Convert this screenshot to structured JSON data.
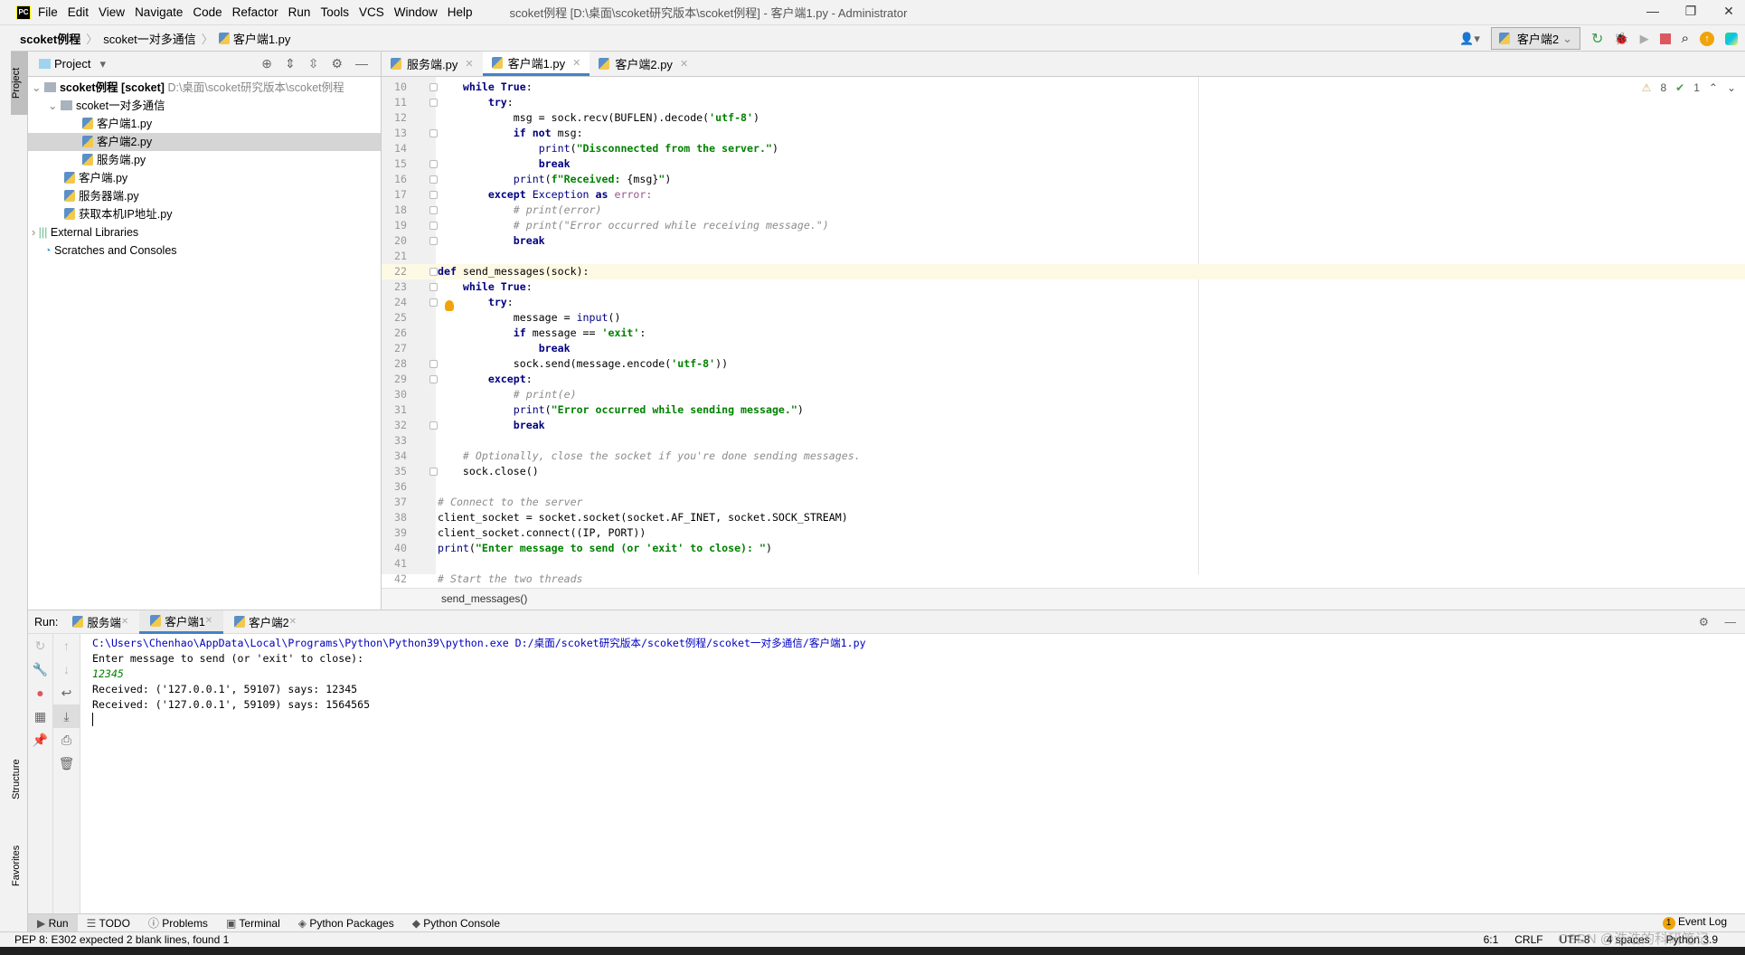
{
  "titlebar": {
    "menus": [
      "File",
      "Edit",
      "View",
      "Navigate",
      "Code",
      "Refactor",
      "Run",
      "Tools",
      "VCS",
      "Window",
      "Help"
    ],
    "title": "scoket例程 [D:\\桌面\\scoket研究版本\\scoket例程] - 客户端1.py - Administrator"
  },
  "navbar": {
    "crumbs": [
      "scoket例程",
      "scoket一对多通信",
      "客户端1.py"
    ],
    "run_config": "客户端2"
  },
  "left_stripe": {
    "project": "Project",
    "structure": "Structure",
    "favorites": "Favorites"
  },
  "project": {
    "header": "Project",
    "root": "scoket例程 [scoket]",
    "root_path": "D:\\桌面\\scoket研究版本\\scoket例程",
    "folder": "scoket一对多通信",
    "files_in_folder": [
      "客户端1.py",
      "客户端2.py",
      "服务端.py"
    ],
    "files": [
      "客户端.py",
      "服务器端.py",
      "获取本机IP地址.py"
    ],
    "external": "External Libraries",
    "scratches": "Scratches and Consoles",
    "selected": "客户端2.py"
  },
  "editor": {
    "tabs": [
      "服务端.py",
      "客户端1.py",
      "客户端2.py"
    ],
    "active_tab": "客户端1.py",
    "warnings": "8",
    "weak_warnings": "1",
    "breadcrumb": "send_messages()",
    "lines": [
      {
        "n": "10",
        "seg": [
          [
            "    ",
            "pl"
          ],
          [
            "while True",
            "kw"
          ],
          [
            ":",
            "pl"
          ]
        ]
      },
      {
        "n": "11",
        "seg": [
          [
            "        ",
            "pl"
          ],
          [
            "try",
            "kw"
          ],
          [
            ":",
            "pl"
          ]
        ]
      },
      {
        "n": "12",
        "seg": [
          [
            "            msg = sock.recv(BUFLEN).decode(",
            "pl"
          ],
          [
            "'utf-8'",
            "str"
          ],
          [
            ")",
            "pl"
          ]
        ]
      },
      {
        "n": "13",
        "seg": [
          [
            "            ",
            "pl"
          ],
          [
            "if not",
            "kw"
          ],
          [
            " msg:",
            "pl"
          ]
        ]
      },
      {
        "n": "14",
        "seg": [
          [
            "                ",
            "pl"
          ],
          [
            "print",
            "bi"
          ],
          [
            "(",
            "pl"
          ],
          [
            "\"Disconnected from the server.\"",
            "str"
          ],
          [
            ")",
            "pl"
          ]
        ]
      },
      {
        "n": "15",
        "seg": [
          [
            "                ",
            "pl"
          ],
          [
            "break",
            "kw"
          ]
        ]
      },
      {
        "n": "16",
        "seg": [
          [
            "            ",
            "pl"
          ],
          [
            "print",
            "bi"
          ],
          [
            "(",
            "pl"
          ],
          [
            "f\"Received: ",
            "str"
          ],
          [
            "{msg}",
            "pl"
          ],
          [
            "\"",
            "str"
          ],
          [
            ")",
            "pl"
          ]
        ]
      },
      {
        "n": "17",
        "seg": [
          [
            "        ",
            "pl"
          ],
          [
            "except",
            "kw"
          ],
          [
            " ",
            "pl"
          ],
          [
            "Exception",
            "bi"
          ],
          [
            " ",
            "pl"
          ],
          [
            "as",
            "kw"
          ],
          [
            " error:",
            "pm"
          ]
        ]
      },
      {
        "n": "18",
        "seg": [
          [
            "            ",
            "pl"
          ],
          [
            "# print(error)",
            "cm"
          ]
        ]
      },
      {
        "n": "19",
        "seg": [
          [
            "            ",
            "pl"
          ],
          [
            "# print(\"Error occurred while receiving message.\")",
            "cm"
          ]
        ]
      },
      {
        "n": "20",
        "seg": [
          [
            "            ",
            "pl"
          ],
          [
            "break",
            "kw"
          ]
        ]
      },
      {
        "n": "21",
        "seg": []
      },
      {
        "n": "22",
        "seg": [
          [
            "def",
            "kw"
          ],
          [
            " send_messages(sock):",
            "pl"
          ]
        ]
      },
      {
        "n": "23",
        "seg": [
          [
            "    ",
            "pl"
          ],
          [
            "while True",
            "kw"
          ],
          [
            ":",
            "pl"
          ]
        ]
      },
      {
        "n": "24",
        "seg": [
          [
            "        ",
            "pl"
          ],
          [
            "try",
            "kw"
          ],
          [
            ":",
            "pl"
          ]
        ]
      },
      {
        "n": "25",
        "seg": [
          [
            "            message = ",
            "pl"
          ],
          [
            "input",
            "bi"
          ],
          [
            "()",
            "pl"
          ]
        ]
      },
      {
        "n": "26",
        "seg": [
          [
            "            ",
            "pl"
          ],
          [
            "if",
            "kw"
          ],
          [
            " message == ",
            "pl"
          ],
          [
            "'exit'",
            "str"
          ],
          [
            ":",
            "pl"
          ]
        ]
      },
      {
        "n": "27",
        "seg": [
          [
            "                ",
            "pl"
          ],
          [
            "break",
            "kw"
          ]
        ]
      },
      {
        "n": "28",
        "seg": [
          [
            "            sock.send(message.encode(",
            "pl"
          ],
          [
            "'utf-8'",
            "str"
          ],
          [
            "))",
            "pl"
          ]
        ]
      },
      {
        "n": "29",
        "seg": [
          [
            "        ",
            "pl"
          ],
          [
            "except",
            "kw"
          ],
          [
            ":",
            "pl"
          ]
        ]
      },
      {
        "n": "30",
        "seg": [
          [
            "            ",
            "pl"
          ],
          [
            "# print(e)",
            "cm"
          ]
        ]
      },
      {
        "n": "31",
        "seg": [
          [
            "            ",
            "pl"
          ],
          [
            "print",
            "bi"
          ],
          [
            "(",
            "pl"
          ],
          [
            "\"Error occurred while sending message.\"",
            "str"
          ],
          [
            ")",
            "pl"
          ]
        ]
      },
      {
        "n": "32",
        "seg": [
          [
            "            ",
            "pl"
          ],
          [
            "break",
            "kw"
          ]
        ]
      },
      {
        "n": "33",
        "seg": []
      },
      {
        "n": "34",
        "seg": [
          [
            "    ",
            "pl"
          ],
          [
            "# Optionally, close the socket if you're done sending messages.",
            "cm"
          ]
        ]
      },
      {
        "n": "35",
        "seg": [
          [
            "    sock.close()",
            "pl"
          ]
        ]
      },
      {
        "n": "36",
        "seg": []
      },
      {
        "n": "37",
        "seg": [
          [
            "# Connect to the server",
            "cm"
          ]
        ]
      },
      {
        "n": "38",
        "seg": [
          [
            "client_socket = socket.socket(socket.AF_INET, socket.SOCK_STREAM)",
            "pl"
          ]
        ]
      },
      {
        "n": "39",
        "seg": [
          [
            "client_socket.connect((IP, PORT))",
            "pl"
          ]
        ]
      },
      {
        "n": "40",
        "seg": [
          [
            "print",
            "bi"
          ],
          [
            "(",
            "pl"
          ],
          [
            "\"Enter message to send (or 'exit' to close): \"",
            "str"
          ],
          [
            ")",
            "pl"
          ]
        ]
      },
      {
        "n": "41",
        "seg": []
      },
      {
        "n": "42",
        "seg": [
          [
            "# Start the two threads",
            "cm"
          ]
        ]
      }
    ],
    "fold_lines": [
      "10",
      "11",
      "13",
      "15",
      "16",
      "17",
      "18",
      "19",
      "20",
      "22",
      "23",
      "24",
      "28",
      "29",
      "32",
      "35"
    ]
  },
  "run": {
    "label": "Run:",
    "tabs": [
      "服务端",
      "客户端1",
      "客户端2"
    ],
    "active_tab": "客户端1",
    "console": [
      {
        "text": "C:\\Users\\Chenhao\\AppData\\Local\\Programs\\Python\\Python39\\python.exe D:/桌面/scoket研究版本/scoket例程/scoket一对多通信/客户端1.py",
        "color": "#0000c0"
      },
      {
        "text": "Enter message to send (or 'exit' to close):",
        "color": "#000000"
      },
      {
        "text": "12345",
        "color": "#008000",
        "italic": true
      },
      {
        "text": "Received: ('127.0.0.1', 59107) says: 12345",
        "color": "#000000"
      },
      {
        "text": "Received: ('127.0.0.1', 59109) says: 1564565",
        "color": "#000000"
      }
    ]
  },
  "bottom_tools": [
    "Run",
    "TODO",
    "Problems",
    "Terminal",
    "Python Packages",
    "Python Console"
  ],
  "event_log": {
    "label": "Event Log",
    "count": "1"
  },
  "status": {
    "message": "PEP 8: E302 expected 2 blank lines, found 1",
    "position": "6:1",
    "line_sep": "CRLF",
    "encoding": "UTF-8",
    "indent": "4 spaces",
    "interpreter": "Python 3.9"
  },
  "watermark": "CSDN @浩浩的科研笔记"
}
